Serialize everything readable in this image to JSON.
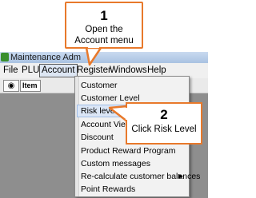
{
  "window": {
    "title": "Maintenance  Adm"
  },
  "menubar": {
    "items": [
      "File",
      "PLU",
      "Account",
      "Register",
      "Windows",
      "Help"
    ]
  },
  "toolbar": {
    "item_label": "Item"
  },
  "account_menu": {
    "items": [
      {
        "label": "Customer"
      },
      {
        "label": "Customer Level"
      },
      {
        "label": "Risk level",
        "highlighted": true
      },
      {
        "label": "Account View"
      },
      {
        "label": "Discount"
      },
      {
        "label": "Product Reward Program"
      },
      {
        "label": "Custom messages"
      },
      {
        "label": "Re-calculate customer balances",
        "has_submenu": true
      },
      {
        "label": "Point Rewards"
      }
    ]
  },
  "callouts": [
    {
      "number": "1",
      "lines": [
        "Open the",
        "Account menu"
      ]
    },
    {
      "number": "2",
      "lines": [
        "Click Risk Level"
      ]
    }
  ],
  "colors": {
    "callout_border": "#e8792b",
    "highlight": "#dbe6f6",
    "content_background": "#8e8e8e"
  }
}
